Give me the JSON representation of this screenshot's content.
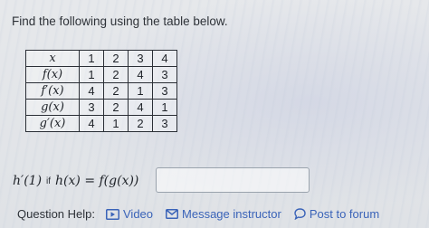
{
  "prompt": "Find the following using the table below.",
  "table": {
    "rows": [
      {
        "label": "x",
        "values": [
          "1",
          "2",
          "3",
          "4"
        ]
      },
      {
        "label": "f(x)",
        "values": [
          "1",
          "2",
          "4",
          "3"
        ]
      },
      {
        "label": "f′(x)",
        "values": [
          "4",
          "2",
          "1",
          "3"
        ]
      },
      {
        "label": "g(x)",
        "values": [
          "3",
          "2",
          "4",
          "1"
        ]
      },
      {
        "label": "g′(x)",
        "values": [
          "4",
          "1",
          "2",
          "3"
        ]
      }
    ]
  },
  "question": {
    "lhs": "h′(1)",
    "if_word": "if",
    "definition": "h(x) = f(g(x))",
    "answer_value": ""
  },
  "help": {
    "label": "Question Help:",
    "video": {
      "label": "Video",
      "icon": "video-icon"
    },
    "message": {
      "label": "Message instructor",
      "icon": "envelope-icon"
    },
    "forum": {
      "label": "Post to forum",
      "icon": "speech-bubble-icon"
    }
  },
  "colors": {
    "link": "#3a63b8",
    "text": "#2e3238",
    "background": "#e3e5e8"
  }
}
